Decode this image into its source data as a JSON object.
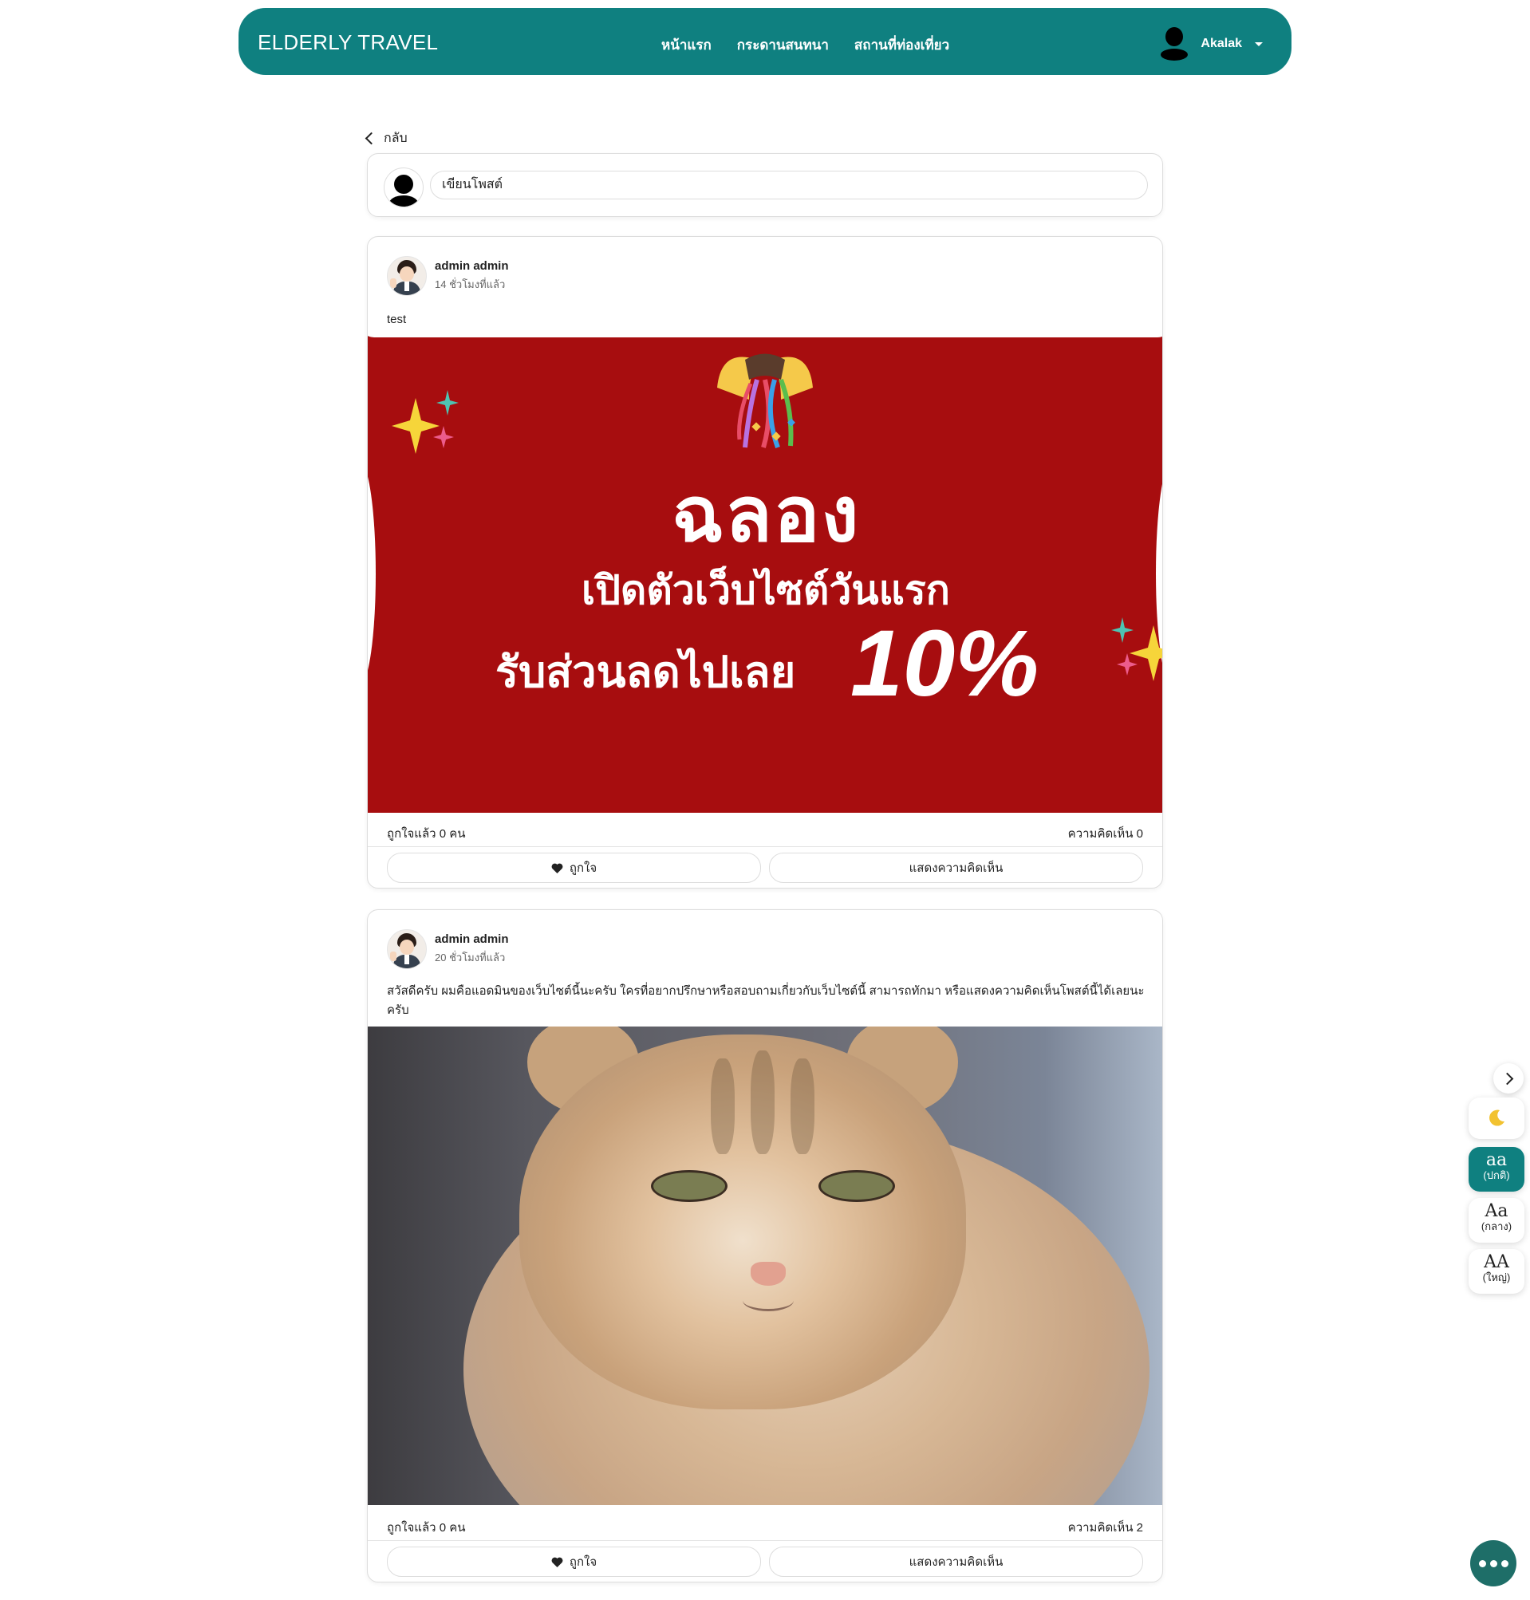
{
  "navbar": {
    "brand": "ELDERLY TRAVEL",
    "links": [
      "หน้าแรก",
      "กระดานสนทนา",
      "สถานที่ท่องเที่ยว"
    ],
    "user": "Akalak"
  },
  "back_label": "กลับ",
  "composer": {
    "placeholder": "เขียนโพสต์"
  },
  "posts": [
    {
      "author": "admin admin",
      "time": "14 ชั่วโมงที่แล้ว",
      "text": "test",
      "image": {
        "kind": "promo-banner",
        "headline": "ฉลอง",
        "line2": "เปิดตัวเว็บไซต์วันแรก",
        "line3": "รับส่วนลดไปเลย",
        "discount": "10%",
        "background": "#a70d0f"
      },
      "likes": "ถูกใจแล้ว 0 คน",
      "comments": "ความคิดเห็น 0",
      "like_btn": "ถูกใจ",
      "comment_btn": "แสดงความคิดเห็น"
    },
    {
      "author": "admin admin",
      "time": "20 ชั่วโมงที่แล้ว",
      "text": "สวัสดีครับ ผมคือแอดมินของเว็บไซต์นี้นะครับ ใครที่อยากปรึกษาหรือสอบถามเกี่ยวกับเว็บไซต์นี้ สามารถทักมา หรือแสดงความคิดเห็นโพสต์นี้ได้เลยนะครับ",
      "image": {
        "kind": "cat-photo"
      },
      "likes": "ถูกใจแล้ว 0 คน",
      "comments": "ความคิดเห็น 2",
      "like_btn": "ถูกใจ",
      "comment_btn": "แสดงความคิดเห็น"
    }
  ],
  "font_tools": [
    {
      "big": "aa",
      "small": "(ปกติ)",
      "active": true
    },
    {
      "big": "Aa",
      "small": "(กลาง)",
      "active": false
    },
    {
      "big": "AA",
      "small": "(ใหญ่)",
      "active": false
    }
  ],
  "icons": {
    "dark_mode": "moon-icon",
    "collapse": "chevron-right-icon",
    "chat": "chat-bubble-icon",
    "like": "heart-icon"
  },
  "colors": {
    "brand": "#0f8080",
    "chat": "#1e6e68"
  }
}
